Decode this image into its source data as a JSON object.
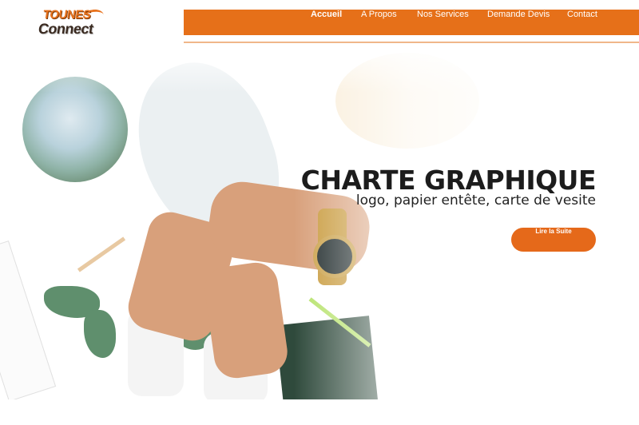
{
  "brand": {
    "logo_line1": "TOUNES",
    "logo_line2": "Connect",
    "accent_color": "#e67019",
    "dark_color": "#3a2a20"
  },
  "nav": {
    "items": [
      {
        "label": "Accueil",
        "active": true
      },
      {
        "label": "A Propos",
        "active": false
      },
      {
        "label": "Nos Services",
        "active": false
      },
      {
        "label": "Demande Devis",
        "active": false
      },
      {
        "label": "Contact",
        "active": false
      }
    ]
  },
  "hero": {
    "title": "CHARTE GRAPHIQUE",
    "subtitle": "logo, papier entête, carte de vesite",
    "button_label": "Lire la Suite",
    "button_color": "#e5691a"
  }
}
